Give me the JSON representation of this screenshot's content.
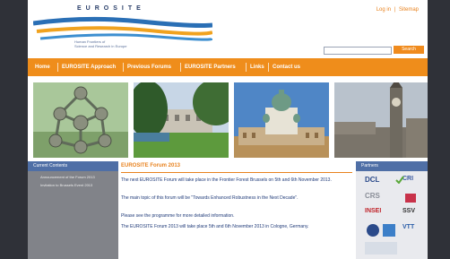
{
  "header": {
    "logo_title": "EUROSITE",
    "logo_subtitle_line1": "Human Frontiers of",
    "logo_subtitle_line2": "Science and Research in Europe",
    "link_login": "Log in",
    "link_sitemap": "Sitemap",
    "search_placeholder": "",
    "search_button": "Search"
  },
  "nav": {
    "items": [
      {
        "label": "Home"
      },
      {
        "label": "EUROSITE Approach"
      },
      {
        "label": "Previous Forums"
      },
      {
        "label": "EUROSITE Partners"
      },
      {
        "label": "Links"
      },
      {
        "label": "Contact us"
      }
    ]
  },
  "left_panel": {
    "heading": "Current Contents",
    "items": [
      {
        "label": "Announcement of the Forum 2013"
      },
      {
        "label": "Invitation to Brussels Event 2013"
      }
    ]
  },
  "main": {
    "heading": "EUROSITE Forum 2013",
    "paragraphs": [
      "The next EUROSITE Forum will take place in the Frontier Forest Brussels on 5th and 6th November 2013.",
      "The main topic of this forum will be \"Towards Enhanced Robustness in the Next Decade\".",
      "Please see the programme for more detailed information.",
      "The EUROSITE Forum 2013 will take place 5th and 6th November 2013 in Cologne, Germany."
    ]
  },
  "right_panel": {
    "heading": "Partners",
    "partners": [
      {
        "label": "DCL"
      },
      {
        "label": "CRI"
      },
      {
        "label": "CRS"
      },
      {
        "label": "INSEI"
      },
      {
        "label": "SSV"
      },
      {
        "label": "VTT"
      }
    ]
  },
  "colors": {
    "nav_bg": "#ef8d1b",
    "panel_head": "#4f6fa6",
    "accent_text": "#e8821e",
    "body_text": "#1f3a78"
  },
  "icons": {
    "photo1": "atomium-image",
    "photo2": "park-image",
    "photo3": "cathedral-image",
    "photo4": "big-ben-image"
  }
}
